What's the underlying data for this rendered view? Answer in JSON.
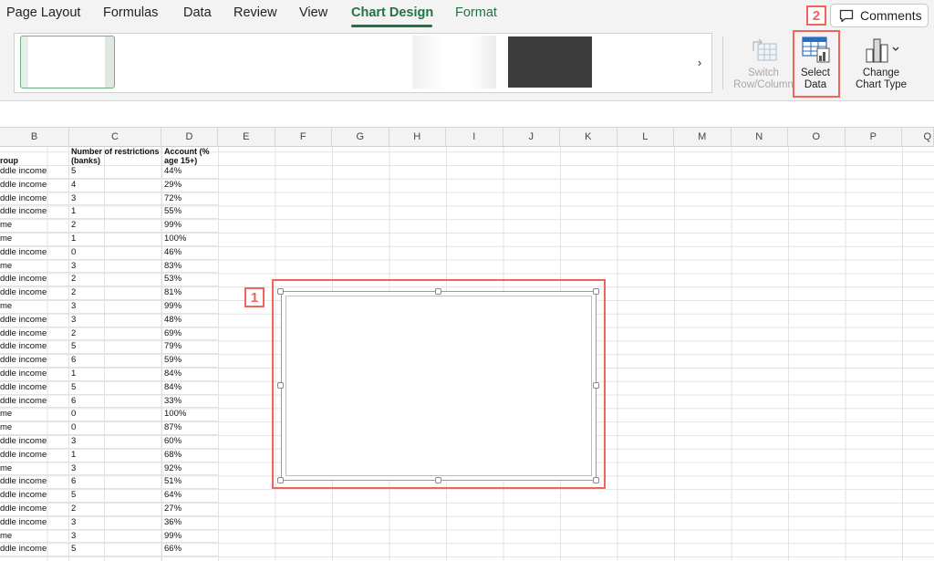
{
  "ribbon": {
    "tabs": [
      "Page Layout",
      "Formulas",
      "Data",
      "Review",
      "View",
      "Chart Design",
      "Format"
    ],
    "active_tab": "Chart Design",
    "comments_label": "Comments",
    "gallery_next": "›",
    "switch_row_column": {
      "line1": "Switch",
      "line2": "Row/Column"
    },
    "select_data": {
      "line1": "Select",
      "line2": "Data"
    },
    "change_chart_type": {
      "line1": "Change",
      "line2": "Chart Type"
    },
    "accent_color": "#217346"
  },
  "columns": [
    "B",
    "C",
    "D",
    "E",
    "F",
    "G",
    "H",
    "I",
    "J",
    "K",
    "L",
    "M",
    "N",
    "O",
    "P",
    "Q"
  ],
  "table": {
    "headers": {
      "b": "roup",
      "c_line1": "Number of restrictions",
      "c_line2": "(banks)",
      "d_line1": "Account (%",
      "d_line2": "age 15+)"
    },
    "rows": [
      [
        "ddle income",
        "5",
        "44%"
      ],
      [
        "ddle income",
        "4",
        "29%"
      ],
      [
        "ddle income",
        "3",
        "72%"
      ],
      [
        "ddle income",
        "1",
        "55%"
      ],
      [
        "me",
        "2",
        "99%"
      ],
      [
        "me",
        "1",
        "100%"
      ],
      [
        "ddle income",
        "0",
        "46%"
      ],
      [
        "me",
        "3",
        "83%"
      ],
      [
        "ddle income",
        "2",
        "53%"
      ],
      [
        "ddle income",
        "2",
        "81%"
      ],
      [
        "me",
        "3",
        "99%"
      ],
      [
        "ddle income",
        "3",
        "48%"
      ],
      [
        "ddle income",
        "2",
        "69%"
      ],
      [
        "ddle income",
        "5",
        "79%"
      ],
      [
        "ddle income",
        "6",
        "59%"
      ],
      [
        "ddle income",
        "1",
        "84%"
      ],
      [
        "ddle income",
        "5",
        "84%"
      ],
      [
        "ddle income",
        "6",
        "33%"
      ],
      [
        "me",
        "0",
        "100%"
      ],
      [
        "me",
        "0",
        "87%"
      ],
      [
        "ddle income",
        "3",
        "60%"
      ],
      [
        "ddle income",
        "1",
        "68%"
      ],
      [
        "me",
        "3",
        "92%"
      ],
      [
        "ddle income",
        "6",
        "51%"
      ],
      [
        "ddle income",
        "5",
        "64%"
      ],
      [
        "ddle income",
        "2",
        "27%"
      ],
      [
        "ddle income",
        "3",
        "36%"
      ],
      [
        "me",
        "3",
        "99%"
      ],
      [
        "ddle income",
        "5",
        "66%"
      ]
    ]
  },
  "callouts": {
    "chart_badge": "1",
    "select_data_badge": "2",
    "color": "#f0645a"
  }
}
